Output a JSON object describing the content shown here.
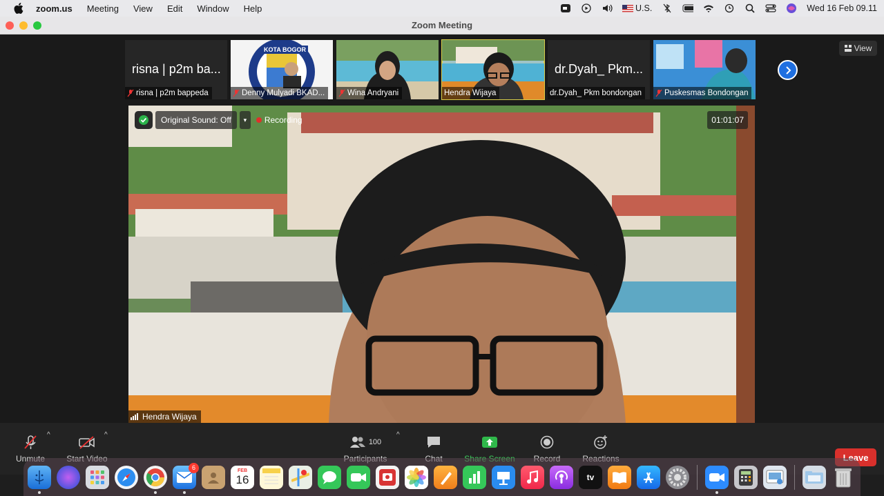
{
  "menubar": {
    "app": "zoom.us",
    "items": [
      "Meeting",
      "View",
      "Edit",
      "Window",
      "Help"
    ],
    "input_source": "U.S.",
    "datetime": "Wed 16 Feb  09.11"
  },
  "window": {
    "title": "Zoom Meeting"
  },
  "view_button": {
    "label": "View"
  },
  "thumbnails": [
    {
      "big_name": "risna | p2m ba...",
      "label": "risna | p2m bappeda",
      "muted": true,
      "active": false
    },
    {
      "big_name": "",
      "label": "Denny Mulyadi BKAD...",
      "muted": true,
      "active": false,
      "overlay_text": "KOTA BOGOR"
    },
    {
      "big_name": "",
      "label": "Wina Andryani",
      "muted": true,
      "active": false
    },
    {
      "big_name": "",
      "label": "Hendra Wijaya",
      "muted": false,
      "active": true
    },
    {
      "big_name": "dr.Dyah_ Pkm...",
      "label": "dr.Dyah_ Pkm bondongan",
      "muted": false,
      "active": false
    },
    {
      "big_name": "",
      "label": "Puskesmas Bondongan",
      "muted": true,
      "active": false
    }
  ],
  "main_video": {
    "original_sound": "Original Sound: Off",
    "recording": "Recording",
    "timer": "01:01:07",
    "speaker": "Hendra Wijaya"
  },
  "toolbar": {
    "unmute": "Unmute",
    "start_video": "Start Video",
    "participants": "Participants",
    "participant_count": "100",
    "chat": "Chat",
    "share_screen": "Share Screen",
    "record": "Record",
    "reactions": "Reactions",
    "leave": "Leave"
  },
  "dock": {
    "calendar_month": "FEB",
    "calendar_day": "16",
    "mail_badge": "6",
    "tv_label": "tv"
  },
  "colors": {
    "accent_blue": "#1f6fe0",
    "leave_red": "#d9302c",
    "share_green": "#3dd05c",
    "active_border": "#d9cd4a"
  }
}
